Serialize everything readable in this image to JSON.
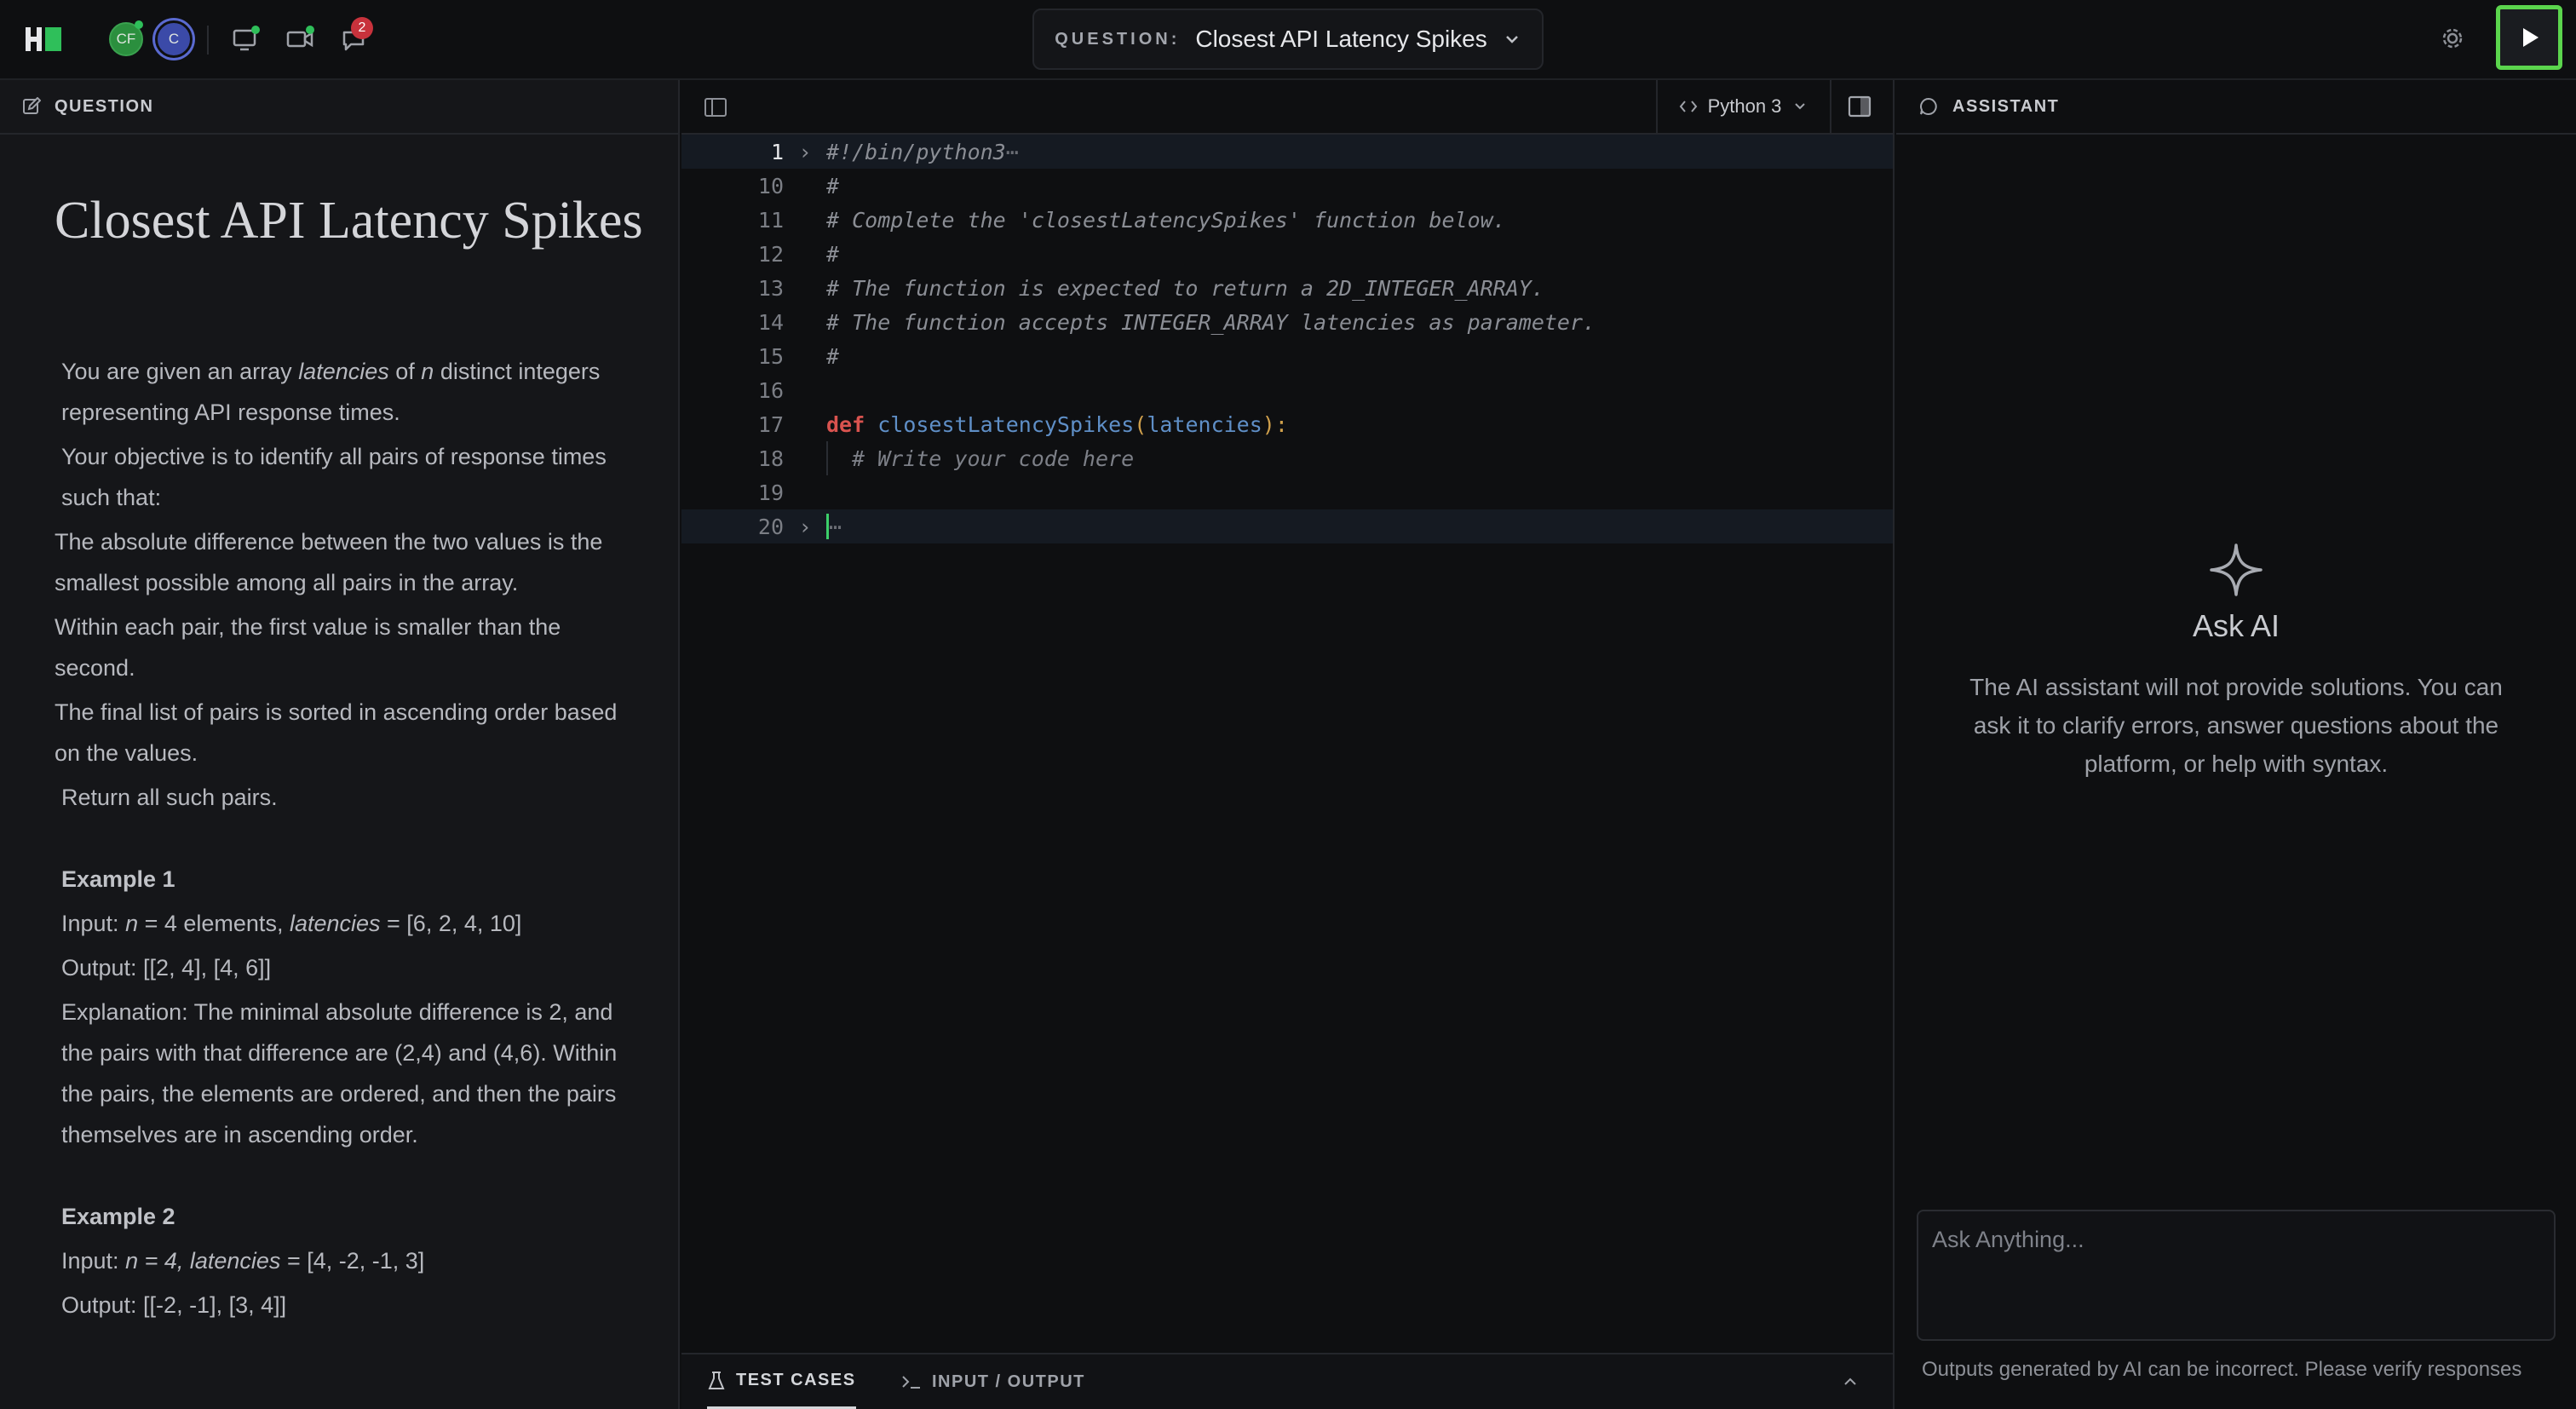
{
  "topbar": {
    "avatars": [
      "CF",
      "C"
    ],
    "notification_count": "2",
    "question_label": "QUESTION:",
    "question_title": "Closest API Latency Spikes"
  },
  "left_panel": {
    "header": "QUESTION",
    "title": "Closest API Latency Spikes",
    "desc": {
      "p1_a": "You are given an array ",
      "p1_var1": "latencies",
      "p1_b": " of ",
      "p1_var2": "n",
      "p1_c": " distinct integers representing API response times.",
      "p2": "Your objective is to identify all pairs of response times such that:",
      "c1": "The absolute difference between the two values is the smallest possible among all pairs in the array.",
      "c2": "Within each pair, the first value is smaller than the second.",
      "c3": "The final list of pairs is sorted in ascending order based on the values.",
      "p3": "Return all such pairs."
    },
    "example1": {
      "heading": "Example 1",
      "input_a": "Input: ",
      "input_n": "n",
      "input_b": " = 4 elements, ",
      "input_var": "latencies",
      "input_c": " = [6, 2, 4, 10]",
      "output": "Output: [[2, 4], [4, 6]]",
      "explanation": "Explanation: The minimal absolute difference is 2, and the pairs with that difference are (2,4) and (4,6). Within the pairs, the elements are ordered, and then the pairs themselves are in ascending order."
    },
    "example2": {
      "heading": "Example 2",
      "input_a": "Input: ",
      "input_it": "n = 4, latencies",
      "input_c": " = [4, -2, -1, 3]",
      "output": "Output: [[-2, -1], [3, 4]]"
    }
  },
  "editor": {
    "language": "Python 3",
    "lines": {
      "l1": {
        "num": "1",
        "text": "#!/bin/python3",
        "ell": "⋯"
      },
      "l10": {
        "num": "10",
        "text": "#"
      },
      "l11": {
        "num": "11",
        "text": "# Complete the 'closestLatencySpikes' function below."
      },
      "l12": {
        "num": "12",
        "text": "#"
      },
      "l13": {
        "num": "13",
        "text": "# The function is expected to return a 2D_INTEGER_ARRAY."
      },
      "l14": {
        "num": "14",
        "text": "# The function accepts INTEGER_ARRAY latencies as parameter."
      },
      "l15": {
        "num": "15",
        "text": "#"
      },
      "l16": {
        "num": "16"
      },
      "l17": {
        "num": "17",
        "kw": "def",
        "fn": "closestLatencySpikes",
        "open": "(",
        "param": "latencies",
        "close": "):"
      },
      "l18": {
        "num": "18",
        "text": "# Write your code here"
      },
      "l19": {
        "num": "19"
      },
      "l20": {
        "num": "20",
        "ell": "⋯"
      }
    },
    "tabs": {
      "test_cases": "TEST CASES",
      "input_output": "INPUT / OUTPUT"
    }
  },
  "assistant": {
    "header": "ASSISTANT",
    "title": "Ask AI",
    "description": "The AI assistant will not provide solutions. You can ask it to clarify errors, answer questions about the platform, or help with syntax.",
    "input_placeholder": "Ask Anything...",
    "disclaimer": "Outputs generated by AI can be incorrect. Please verify responses"
  }
}
